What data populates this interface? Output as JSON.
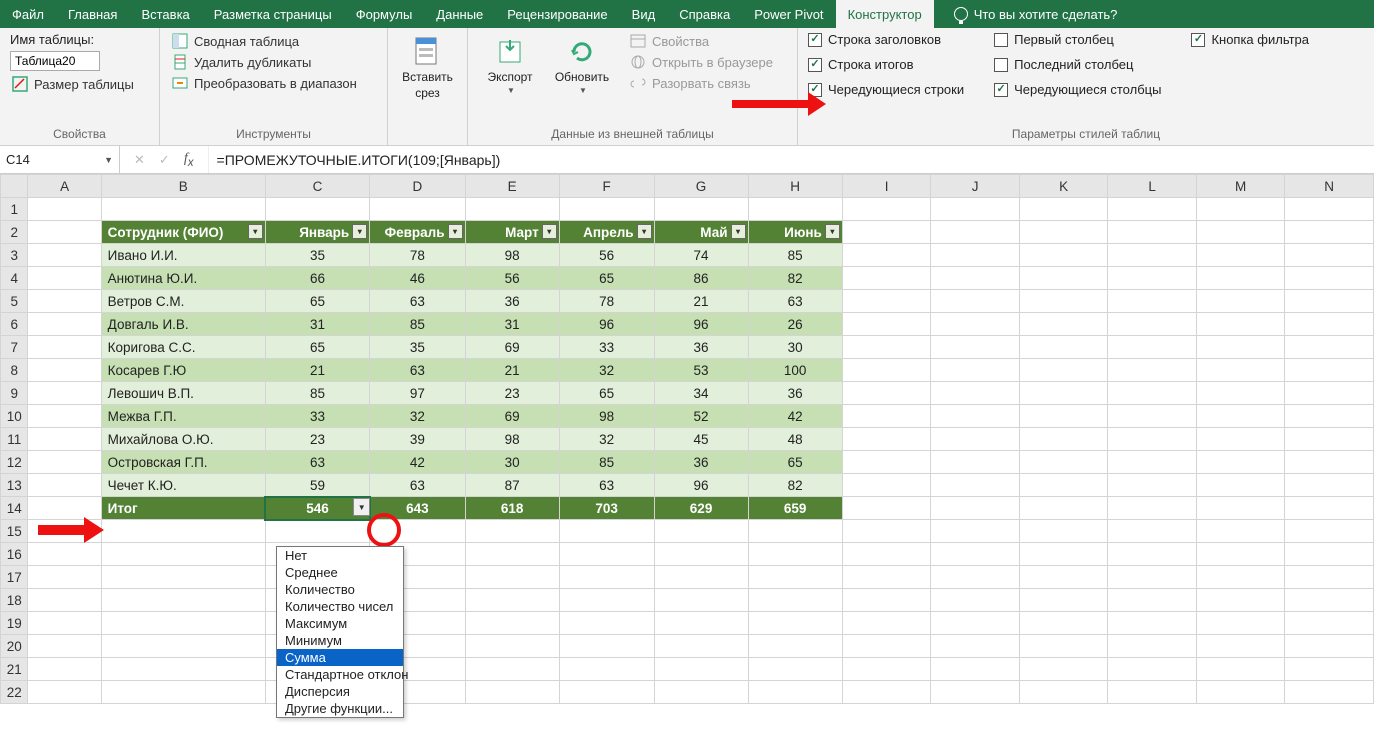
{
  "tabs": [
    "Файл",
    "Главная",
    "Вставка",
    "Разметка страницы",
    "Формулы",
    "Данные",
    "Рецензирование",
    "Вид",
    "Справка",
    "Power Pivot",
    "Конструктор"
  ],
  "tell_me": "Что вы хотите сделать?",
  "group_props": {
    "title_label": "Имя таблицы:",
    "table_name": "Таблица20",
    "resize": "Размер таблицы",
    "caption": "Свойства"
  },
  "group_tools": {
    "pivot": "Сводная таблица",
    "dedup": "Удалить дубликаты",
    "convert": "Преобразовать в диапазон",
    "caption": "Инструменты"
  },
  "group_slicer": {
    "label": "Вставить",
    "label2": "срез"
  },
  "group_export": {
    "export": "Экспорт",
    "refresh": "Обновить"
  },
  "group_ext": {
    "props": "Свойства",
    "open": "Открыть в браузере",
    "unlink": "Разорвать связь",
    "caption": "Данные из внешней таблицы"
  },
  "group_styleopts": {
    "header_row": "Строка заголовков",
    "total_row": "Строка итогов",
    "banded_rows": "Чередующиеся строки",
    "first_col": "Первый столбец",
    "last_col": "Последний столбец",
    "banded_cols": "Чередующиеся столбцы",
    "filter_btn": "Кнопка фильтра",
    "caption": "Параметры стилей таблиц"
  },
  "namebox": "C14",
  "formula": "=ПРОМЕЖУТОЧНЫЕ.ИТОГИ(109;[Январь])",
  "col_headers": [
    "A",
    "B",
    "C",
    "D",
    "E",
    "F",
    "G",
    "H",
    "I",
    "J",
    "K",
    "L",
    "M",
    "N"
  ],
  "table": {
    "headers": [
      "Сотрудник (ФИО)",
      "Январь",
      "Февраль",
      "Март",
      "Апрель",
      "Май",
      "Июнь"
    ],
    "rows": [
      {
        "name": "Ивано И.И.",
        "vals": [
          35,
          78,
          98,
          56,
          74,
          85
        ]
      },
      {
        "name": "Анютина Ю.И.",
        "vals": [
          66,
          46,
          56,
          65,
          86,
          82
        ]
      },
      {
        "name": "Ветров С.М.",
        "vals": [
          65,
          63,
          36,
          78,
          21,
          63
        ]
      },
      {
        "name": "Довгаль И.В.",
        "vals": [
          31,
          85,
          31,
          96,
          96,
          26
        ]
      },
      {
        "name": "Коригова С.С.",
        "vals": [
          65,
          35,
          69,
          33,
          36,
          30
        ]
      },
      {
        "name": "Косарев Г.Ю",
        "vals": [
          21,
          63,
          21,
          32,
          53,
          100
        ]
      },
      {
        "name": "Левошич В.П.",
        "vals": [
          85,
          97,
          23,
          65,
          34,
          36
        ]
      },
      {
        "name": "Межва Г.П.",
        "vals": [
          33,
          32,
          69,
          98,
          52,
          42
        ]
      },
      {
        "name": "Михайлова О.Ю.",
        "vals": [
          23,
          39,
          98,
          32,
          45,
          48
        ]
      },
      {
        "name": "Островская Г.П.",
        "vals": [
          63,
          42,
          30,
          85,
          36,
          65
        ]
      },
      {
        "name": "Чечет К.Ю.",
        "vals": [
          59,
          63,
          87,
          63,
          96,
          82
        ]
      }
    ],
    "total_label": "Итог",
    "totals": [
      546,
      643,
      618,
      703,
      629,
      659
    ]
  },
  "dropdown": [
    "Нет",
    "Среднее",
    "Количество",
    "Количество чисел",
    "Максимум",
    "Минимум",
    "Сумма",
    "Стандартное отклон",
    "Дисперсия",
    "Другие функции..."
  ],
  "dropdown_selected": "Сумма"
}
